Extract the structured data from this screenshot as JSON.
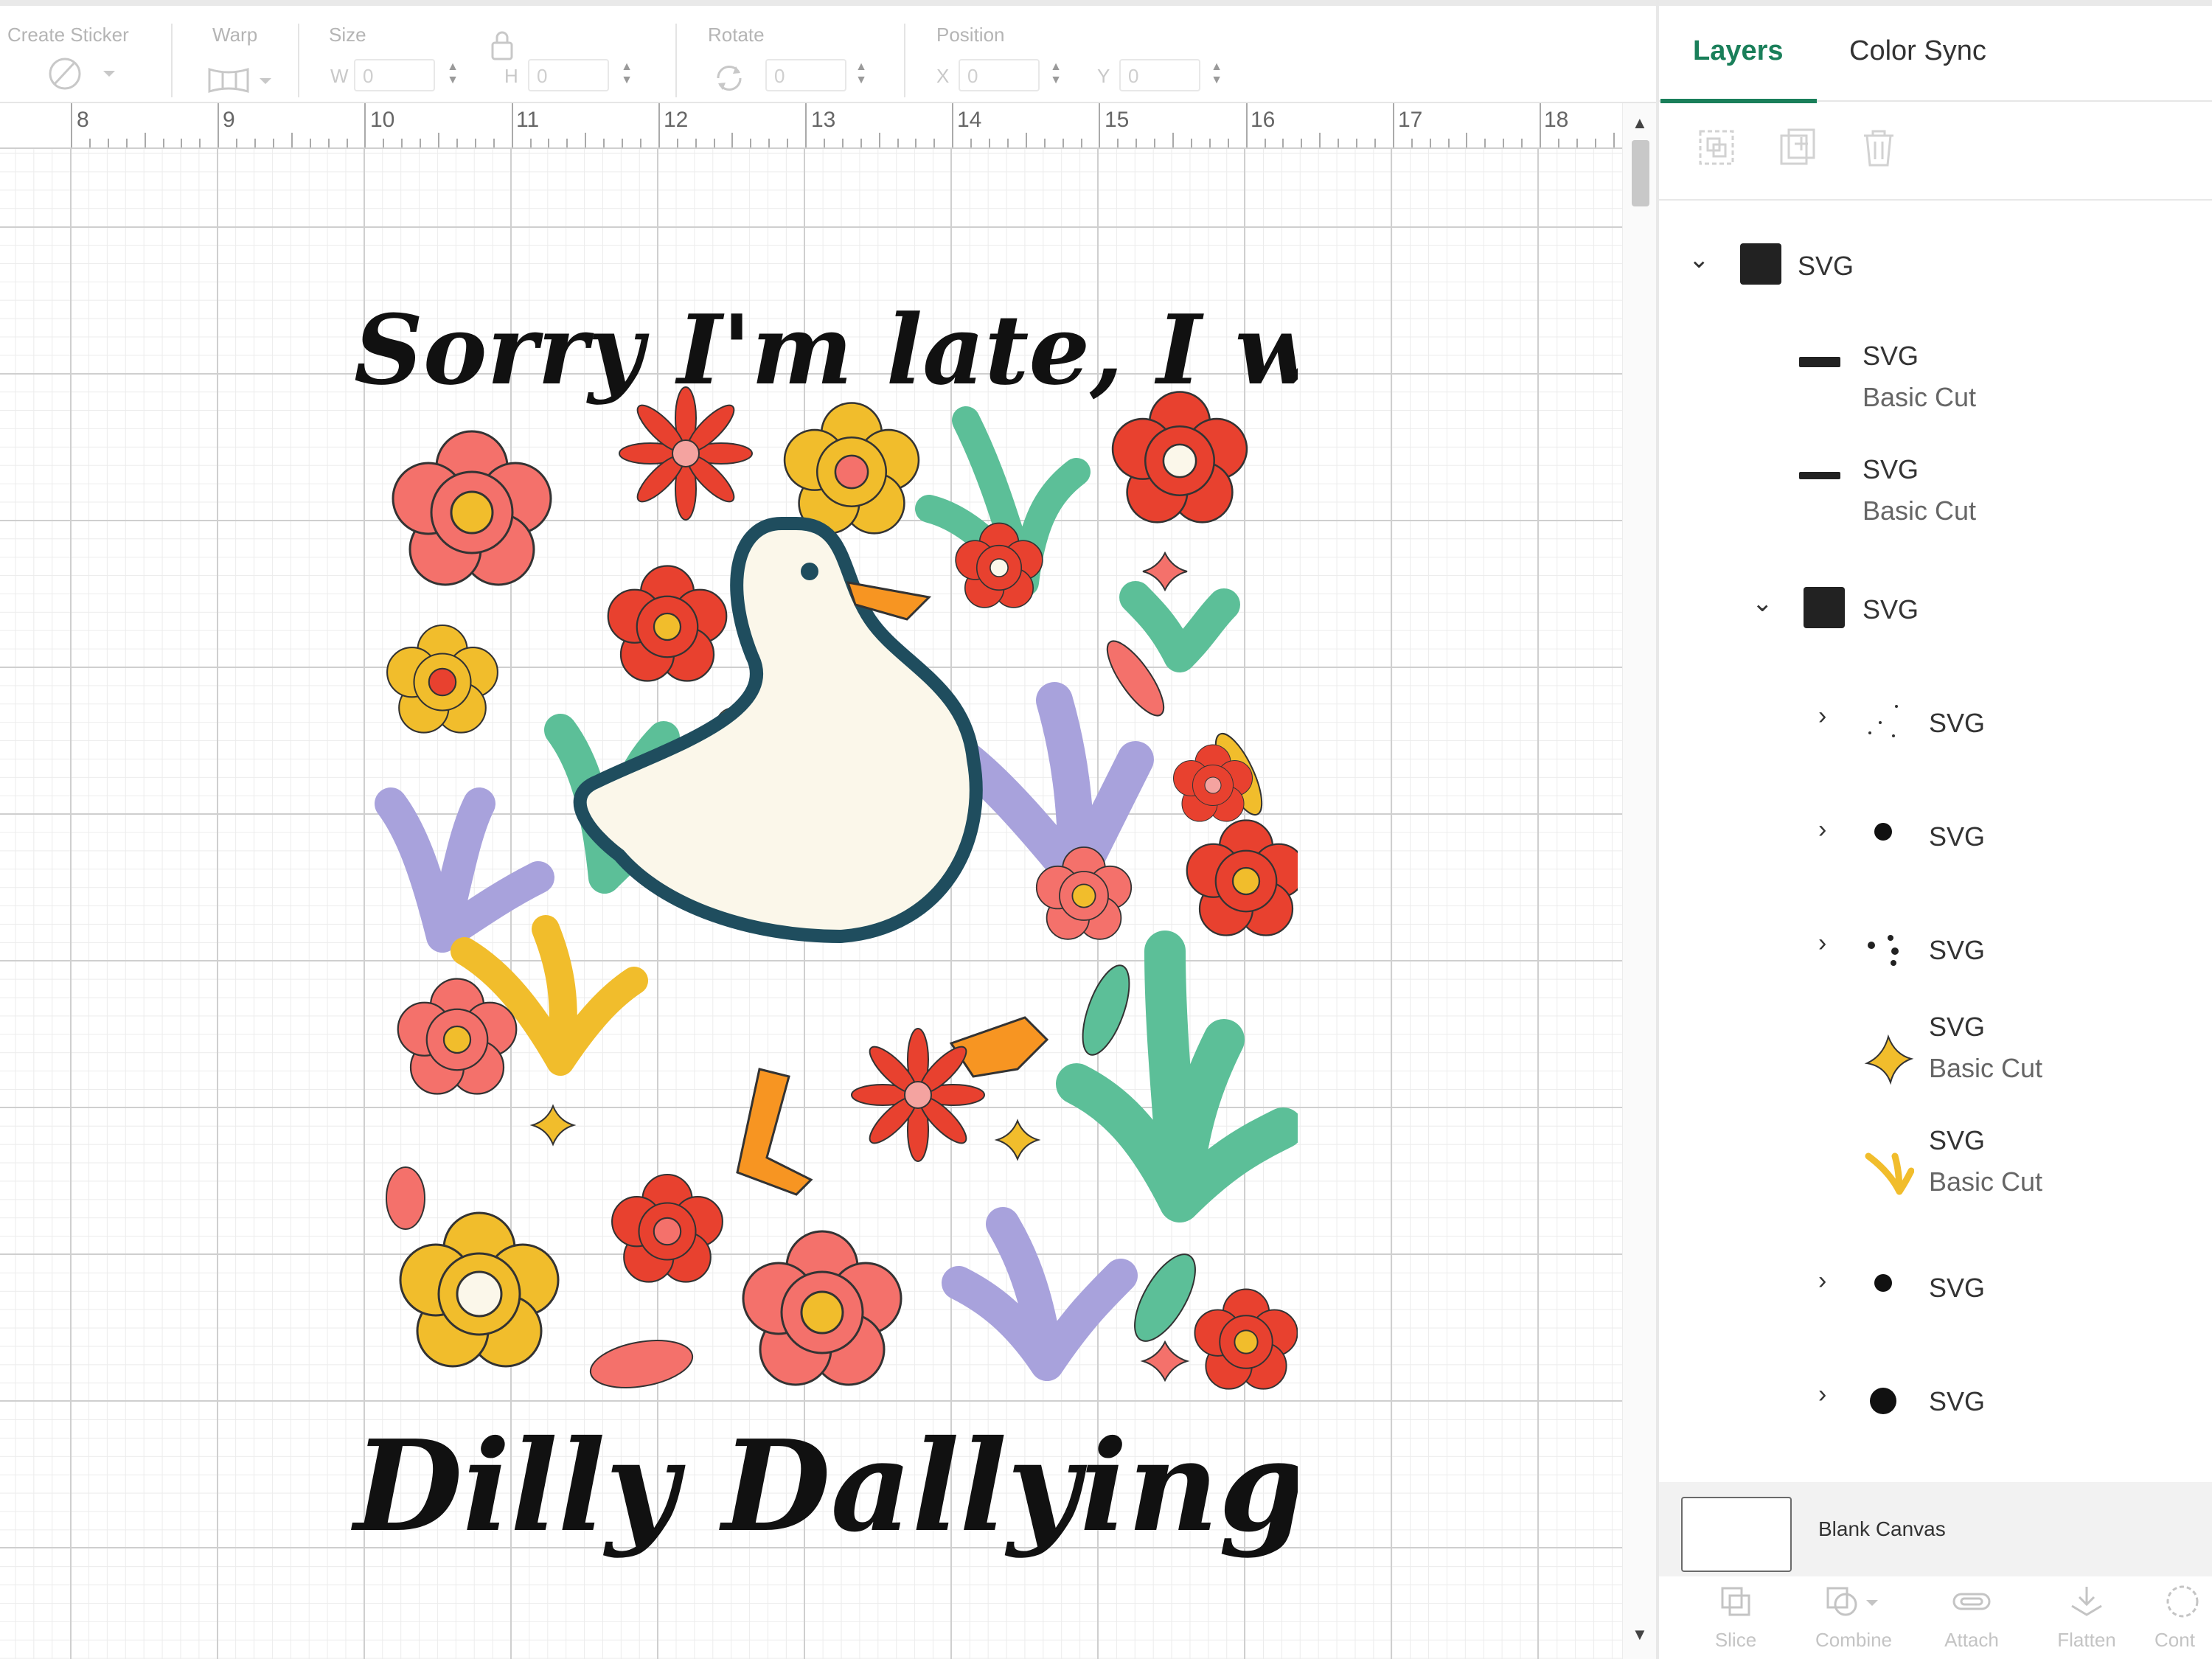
{
  "toolbar": {
    "create_sticker": "Create Sticker",
    "warp": "Warp",
    "size": "Size",
    "w_label": "W",
    "w_value": "0",
    "h_label": "H",
    "h_value": "0",
    "rotate": "Rotate",
    "rotate_value": "0",
    "position": "Position",
    "x_label": "X",
    "x_value": "0",
    "y_label": "Y",
    "y_value": "0"
  },
  "ruler": {
    "marks": [
      "8",
      "9",
      "10",
      "11",
      "12",
      "13",
      "14",
      "15",
      "16",
      "17",
      "18"
    ]
  },
  "artwork": {
    "line1": "Sorry I'm late, I was",
    "line2": "Dilly Dallying"
  },
  "panel": {
    "tabs": [
      "Layers",
      "Color Sync"
    ],
    "layers": [
      {
        "name": "SVG",
        "sub": ""
      },
      {
        "name": "SVG",
        "sub": "Basic Cut"
      },
      {
        "name": "SVG",
        "sub": "Basic Cut"
      },
      {
        "name": "SVG",
        "sub": ""
      },
      {
        "name": "SVG",
        "sub": ""
      },
      {
        "name": "SVG",
        "sub": ""
      },
      {
        "name": "SVG",
        "sub": ""
      },
      {
        "name": "SVG",
        "sub": "Basic Cut"
      },
      {
        "name": "SVG",
        "sub": "Basic Cut"
      },
      {
        "name": "SVG",
        "sub": ""
      },
      {
        "name": "SVG",
        "sub": ""
      }
    ],
    "blank_canvas": "Blank Canvas",
    "bottom_tools": [
      "Slice",
      "Combine",
      "Attach",
      "Flatten",
      "Cont"
    ]
  },
  "colors": {
    "accent": "#1a7f5a",
    "coral": "#f4716b",
    "red": "#e8412f",
    "yellow": "#f1bd2c",
    "teal": "#5cbf98",
    "lavender": "#a8a2dc",
    "orange": "#f79522",
    "cream": "#fbf7ea",
    "navy": "#1f4d5e"
  }
}
